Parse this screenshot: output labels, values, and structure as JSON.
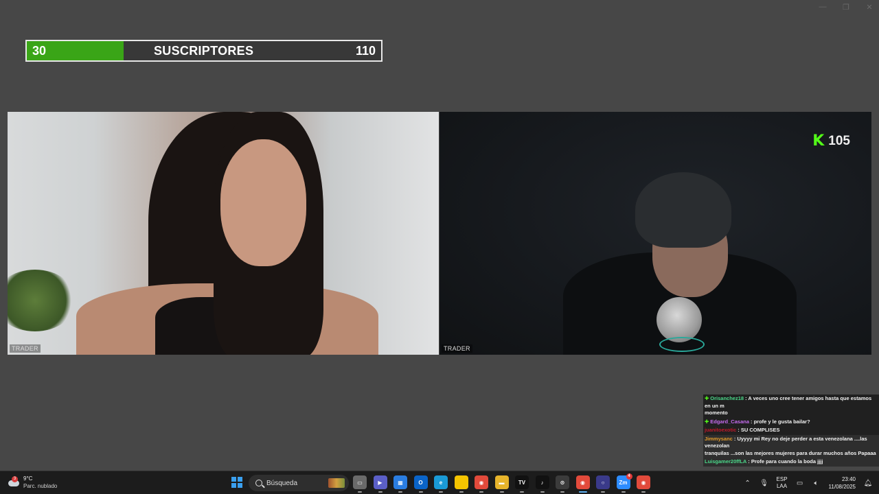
{
  "window_controls": [
    "—",
    "❐",
    "✕"
  ],
  "goal": {
    "current": "30",
    "label": "SUSCRIPTORES",
    "target": "110",
    "progress_fraction": 0.273,
    "fill_color": "#3aa517"
  },
  "cameras": {
    "left_label": "TRADER",
    "right_label": "TRADER"
  },
  "kick_badge": {
    "icon": "kick-logo-icon",
    "glyph": "K",
    "viewers": "105",
    "color": "#53fc18"
  },
  "chat": [
    {
      "star": true,
      "user": "Orisanchez18",
      "user_color": "#4bd98a",
      "text": "A veces uno cree tener amigos hasta que estamos en un m",
      "cont": "momento",
      "style": "hl"
    },
    {
      "star": true,
      "user": "Edgard_Casana",
      "user_color": "#c66cf0",
      "text": "profe y le gusta bailar?",
      "style": "hl"
    },
    {
      "star": false,
      "user": "juanitoexotic",
      "user_color": "#c0182a",
      "text": "SU COMPLISES",
      "style": "hl"
    },
    {
      "star": false,
      "user": "Jimmysanc",
      "user_color": "#e09a2a",
      "text": "Uyyyy mi Rey no deje perder a esta venezolana ....las venezolan",
      "cont": "tranquilas ...son las mejores mujeres para durar muchos años Papaaa",
      "style": "hl2"
    },
    {
      "star": false,
      "user": "Luisgamer20ffLA",
      "user_color": "#4bd98a",
      "text": "Profe para cuando la boda jjjj",
      "style": "hl2"
    }
  ],
  "taskbar": {
    "weather": {
      "temp": "9°C",
      "desc": "Parc. nublado",
      "badge": "3"
    },
    "search_placeholder": "Búsqueda",
    "apps": [
      {
        "name": "task-view-icon",
        "color": "#6a6a6a",
        "glyph": "▭"
      },
      {
        "name": "teams-icon",
        "color": "#5b5fc7",
        "glyph": "▶"
      },
      {
        "name": "store-icon",
        "color": "#2a7de1",
        "glyph": "▦"
      },
      {
        "name": "outlook-icon",
        "color": "#0a64c8",
        "glyph": "O"
      },
      {
        "name": "edge-icon",
        "color": "#1a9ad6",
        "glyph": "e"
      },
      {
        "name": "sticky-notes-icon",
        "color": "#f5c400",
        "glyph": ""
      },
      {
        "name": "chrome-icon",
        "color": "#e24a3b",
        "glyph": "◉"
      },
      {
        "name": "file-explorer-icon",
        "color": "#e7b42b",
        "glyph": "▬"
      },
      {
        "name": "tradingview-icon",
        "color": "#111111",
        "glyph": "TV"
      },
      {
        "name": "tiktok-icon",
        "color": "#111111",
        "glyph": "♪"
      },
      {
        "name": "recorder-icon",
        "color": "#3b3b3b",
        "glyph": "⊙"
      },
      {
        "name": "chrome-active-icon",
        "color": "#e24a3b",
        "glyph": "◉",
        "active": true
      },
      {
        "name": "cortana-icon",
        "color": "#3a3a8a",
        "glyph": "○"
      },
      {
        "name": "zoom-icon",
        "color": "#2d8cff",
        "glyph": "Zm",
        "badge": "4"
      },
      {
        "name": "chrome-profile-icon",
        "color": "#e24a3b",
        "glyph": "◉"
      }
    ],
    "tray": {
      "lang_top": "ESP",
      "lang_bottom": "LAA",
      "time": "23:40",
      "date": "11/08/2025"
    }
  }
}
